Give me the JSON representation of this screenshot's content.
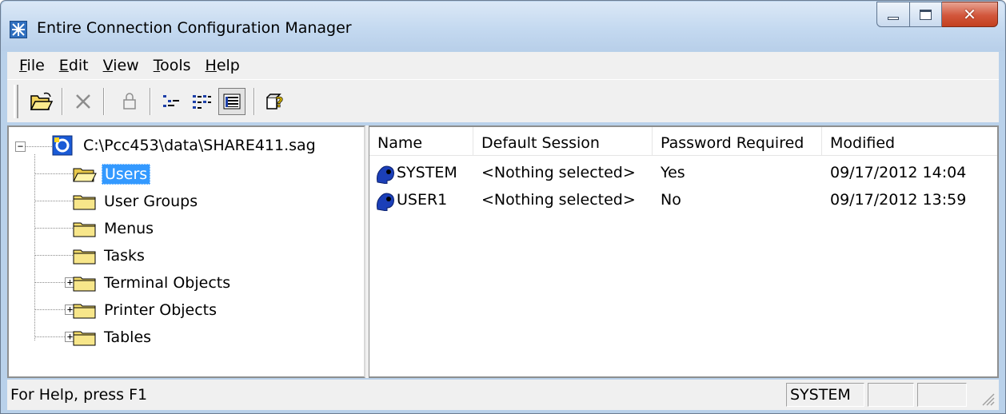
{
  "window": {
    "title": "Entire Connection Configuration Manager",
    "title_color": "#b9d1ea",
    "close_color": "#c3401f"
  },
  "menu": {
    "items": [
      {
        "label": "File",
        "underline": "F",
        "rest": "ile"
      },
      {
        "label": "Edit",
        "underline": "E",
        "rest": "dit"
      },
      {
        "label": "View",
        "underline": "V",
        "rest": "iew"
      },
      {
        "label": "Tools",
        "underline": "T",
        "rest": "ools"
      },
      {
        "label": "Help",
        "underline": "H",
        "rest": "elp"
      }
    ]
  },
  "toolbar": {
    "buttons": [
      "open-folder-icon",
      "delete-icon",
      "lock-icon",
      "tree-view-icon",
      "list-view-icon",
      "details-view-icon",
      "help-icon"
    ],
    "pressed": "details-view-icon"
  },
  "tree": {
    "root": "C:\\Pcc453\\data\\SHARE411.sag",
    "nodes": [
      {
        "label": "Users",
        "selected": true,
        "expandable": false,
        "open": true
      },
      {
        "label": "User Groups",
        "selected": false,
        "expandable": false
      },
      {
        "label": "Menus",
        "selected": false,
        "expandable": false
      },
      {
        "label": "Tasks",
        "selected": false,
        "expandable": false
      },
      {
        "label": "Terminal Objects",
        "selected": false,
        "expandable": true
      },
      {
        "label": "Printer Objects",
        "selected": false,
        "expandable": true
      },
      {
        "label": "Tables",
        "selected": false,
        "expandable": true
      }
    ],
    "selection_color": "#3399ff"
  },
  "list": {
    "columns": [
      "Name",
      "Default Session",
      "Password Required",
      "Modified"
    ],
    "rows": [
      {
        "name": "SYSTEM",
        "session": "<Nothing selected>",
        "password": "Yes",
        "modified": "09/17/2012 14:04"
      },
      {
        "name": "USER1",
        "session": "<Nothing selected>",
        "password": "No",
        "modified": "09/17/2012 13:59"
      }
    ]
  },
  "status": {
    "help_text": "For Help, press F1",
    "user": "SYSTEM"
  }
}
